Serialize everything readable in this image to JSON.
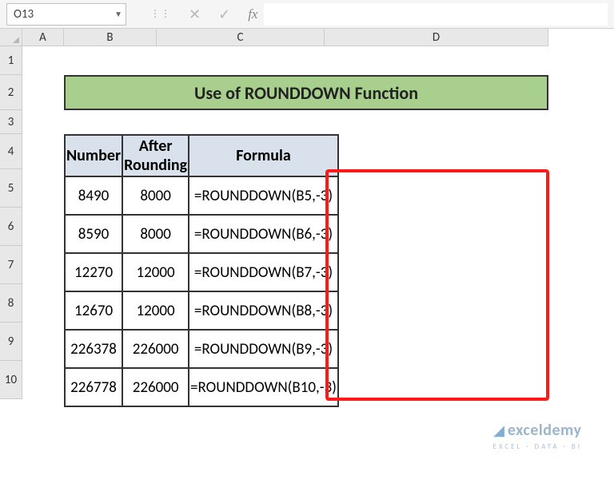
{
  "namebox": {
    "cell_ref": "O13"
  },
  "fx_label": "fx",
  "col_labels": [
    "A",
    "B",
    "C",
    "D"
  ],
  "row_labels": [
    "1",
    "2",
    "3",
    "4",
    "5",
    "6",
    "7",
    "8",
    "9",
    "10"
  ],
  "title": "Use of ROUNDDOWN Function",
  "headers": {
    "b": "Number",
    "c": "After Rounding",
    "d": "Formula"
  },
  "rows": [
    {
      "number": "8490",
      "after": "8000",
      "formula": "=ROUNDDOWN(B5,-3)"
    },
    {
      "number": "8590",
      "after": "8000",
      "formula": "=ROUNDDOWN(B6,-3)"
    },
    {
      "number": "12270",
      "after": "12000",
      "formula": "=ROUNDDOWN(B7,-3)"
    },
    {
      "number": "12670",
      "after": "12000",
      "formula": "=ROUNDDOWN(B8,-3)"
    },
    {
      "number": "226378",
      "after": "226000",
      "formula": "=ROUNDDOWN(B9,-3)"
    },
    {
      "number": "226778",
      "after": "226000",
      "formula": "=ROUNDDOWN(B10,-3)"
    }
  ],
  "watermark": {
    "brand": "exceldemy",
    "sub": "EXCEL · DATA · BI"
  }
}
